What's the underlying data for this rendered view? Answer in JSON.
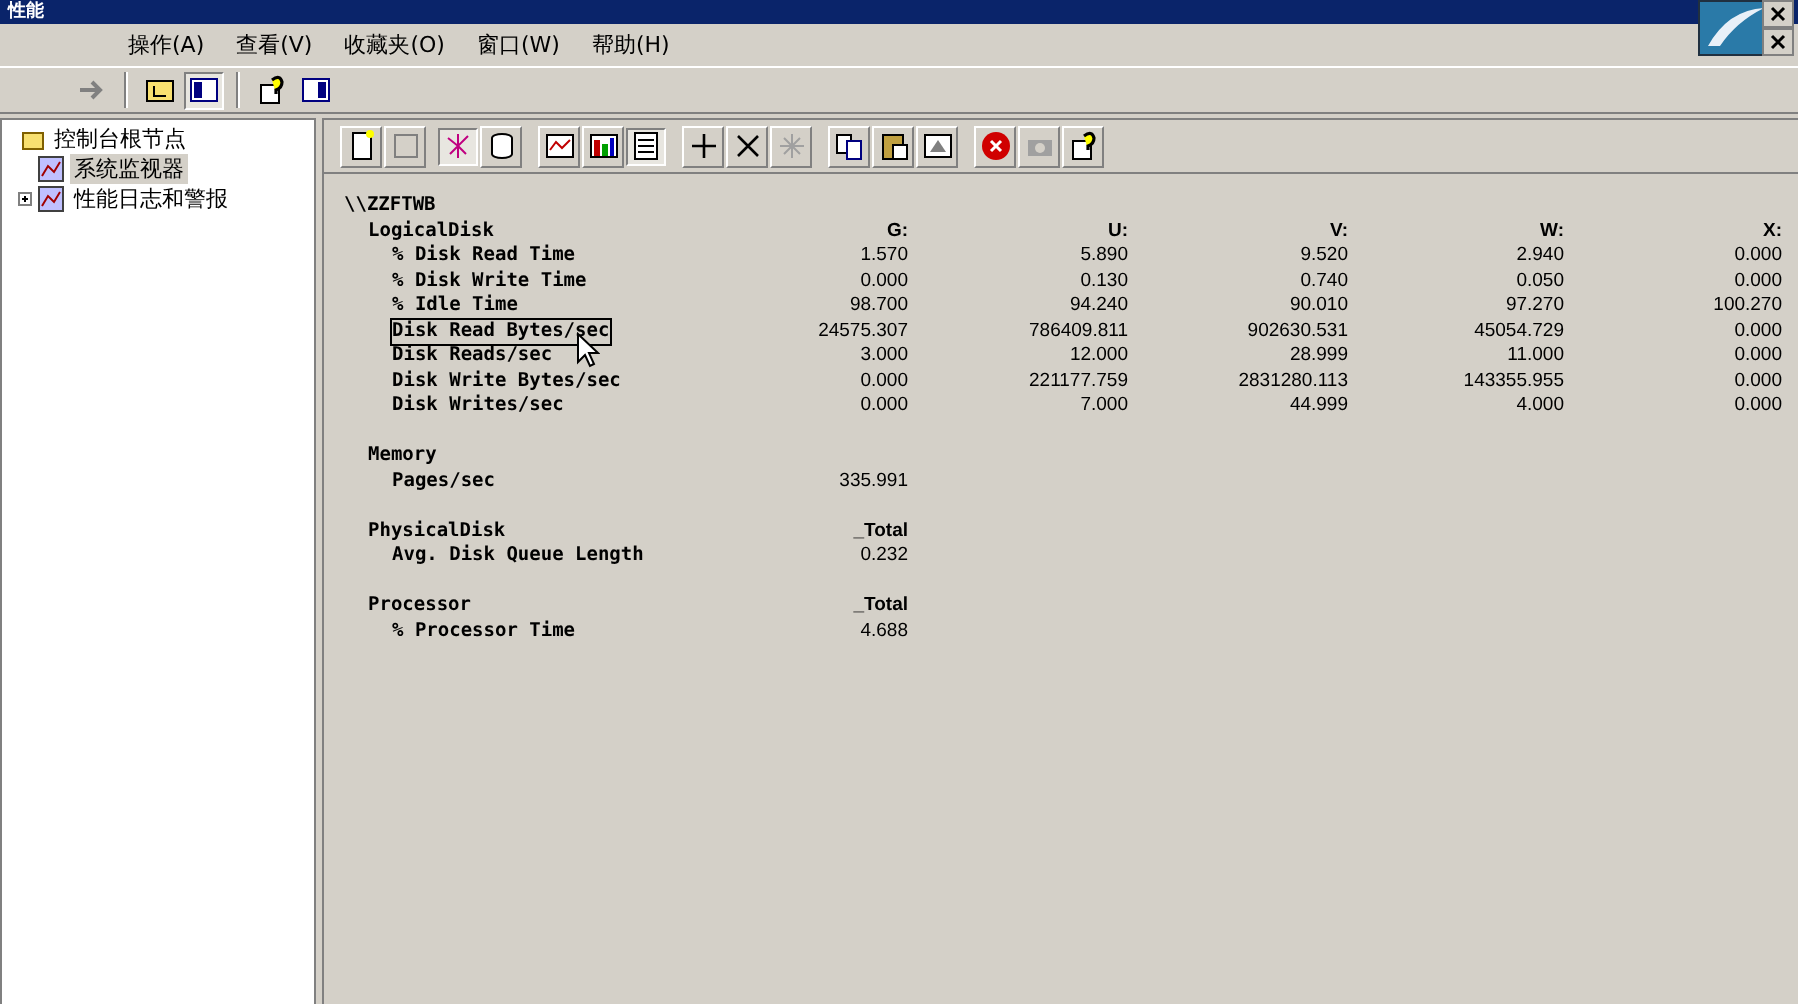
{
  "window": {
    "title": "性能"
  },
  "menu": [
    "操作(A)",
    "查看(V)",
    "收藏夹(O)",
    "窗口(W)",
    "帮助(H)"
  ],
  "tree": [
    {
      "label": "控制台根节点",
      "expanded": true,
      "selected": false,
      "children": [
        {
          "label": "系统监视器",
          "selected": false,
          "highlighted": true
        },
        {
          "label": "性能日志和警报",
          "selected": false,
          "expanded": false
        }
      ]
    }
  ],
  "report": {
    "machine": "\\\\ZZFTWB",
    "objects": [
      {
        "name": "LogicalDisk",
        "instances": [
          "G:",
          "U:",
          "V:",
          "W:",
          "X:"
        ],
        "counters": [
          {
            "name": "% Disk Read Time",
            "selected": false,
            "values": [
              "1.570",
              "5.890",
              "9.520",
              "2.940",
              "0.000"
            ]
          },
          {
            "name": "% Disk Write Time",
            "selected": false,
            "values": [
              "0.000",
              "0.130",
              "0.740",
              "0.050",
              "0.000"
            ]
          },
          {
            "name": "% Idle Time",
            "selected": false,
            "values": [
              "98.700",
              "94.240",
              "90.010",
              "97.270",
              "100.270"
            ]
          },
          {
            "name": "Disk Read Bytes/sec",
            "selected": true,
            "values": [
              "24575.307",
              "786409.811",
              "902630.531",
              "45054.729",
              "0.000"
            ]
          },
          {
            "name": "Disk Reads/sec",
            "selected": false,
            "values": [
              "3.000",
              "12.000",
              "28.999",
              "11.000",
              "0.000"
            ]
          },
          {
            "name": "Disk Write Bytes/sec",
            "selected": false,
            "values": [
              "0.000",
              "221177.759",
              "2831280.113",
              "143355.955",
              "0.000"
            ]
          },
          {
            "name": "Disk Writes/sec",
            "selected": false,
            "values": [
              "0.000",
              "7.000",
              "44.999",
              "4.000",
              "0.000"
            ]
          }
        ]
      },
      {
        "name": "Memory",
        "counters": [
          {
            "name": "Pages/sec",
            "selected": false,
            "values": [
              "335.991"
            ]
          }
        ]
      },
      {
        "name": "PhysicalDisk",
        "instances": [
          "_Total"
        ],
        "counters": [
          {
            "name": "Avg. Disk Queue Length",
            "selected": false,
            "values": [
              "0.232"
            ]
          }
        ]
      },
      {
        "name": "Processor",
        "instances": [
          "_Total"
        ],
        "counters": [
          {
            "name": "% Processor Time",
            "selected": false,
            "values": [
              "4.688"
            ]
          }
        ]
      }
    ]
  }
}
